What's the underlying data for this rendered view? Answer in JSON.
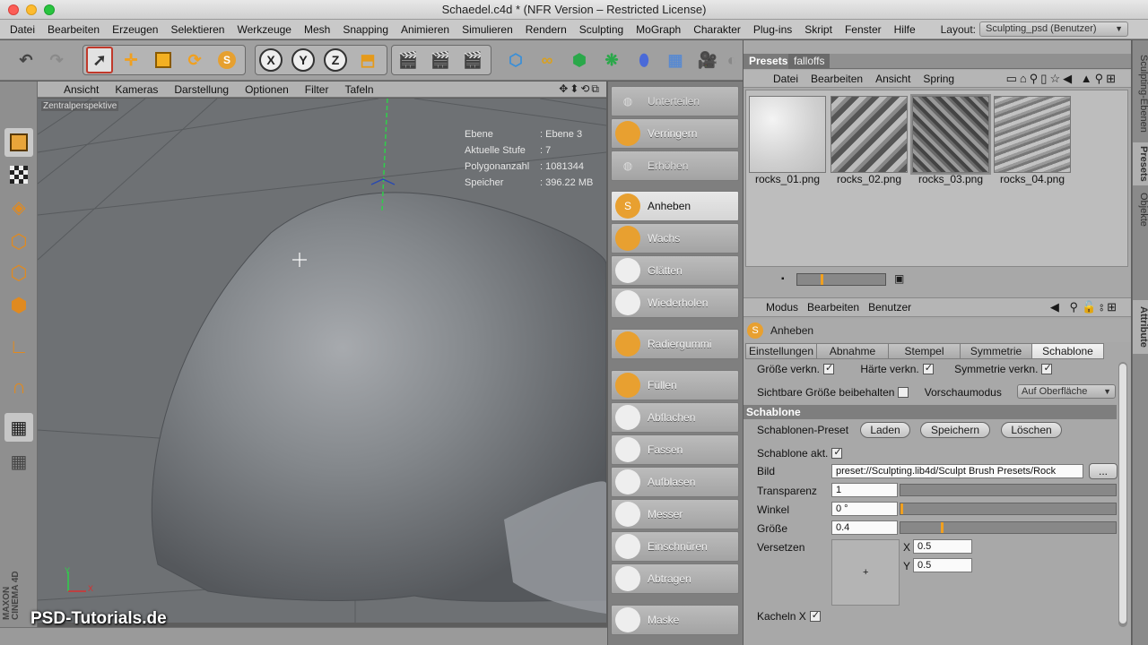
{
  "window": {
    "title": "Schaedel.c4d * (NFR Version – Restricted License)"
  },
  "menubar": {
    "items": [
      "Datei",
      "Bearbeiten",
      "Erzeugen",
      "Selektieren",
      "Werkzeuge",
      "Mesh",
      "Snapping",
      "Animieren",
      "Simulieren",
      "Rendern",
      "Sculpting",
      "MoGraph",
      "Charakter",
      "Plug-ins",
      "Skript",
      "Fenster",
      "Hilfe"
    ],
    "layout_label": "Layout:",
    "layout_value": "Sculpting_psd (Benutzer)"
  },
  "toolbar": {
    "axes": [
      "X",
      "Y",
      "Z"
    ]
  },
  "viewport": {
    "menu": [
      "Ansicht",
      "Kameras",
      "Darstellung",
      "Optionen",
      "Filter",
      "Tafeln"
    ],
    "camera_label": "Zentralperspektive",
    "hud": [
      {
        "key": "Ebene",
        "value": ": Ebene 3"
      },
      {
        "key": "Aktuelle Stufe",
        "value": ": 7"
      },
      {
        "key": "Polygonanzahl",
        "value": ": 1081344"
      },
      {
        "key": "Speicher",
        "value": ": 396.22 MB"
      }
    ],
    "watermark": "PSD-Tutorials.de",
    "brand": "MAXON CINEMA 4D",
    "axis_y": "Y",
    "axis_x": "X"
  },
  "brushes": [
    {
      "label": "Unterteilen",
      "state": "dim"
    },
    {
      "label": "Verringern",
      "state": "normal"
    },
    {
      "label": "Erhöhen",
      "state": "dim"
    },
    {
      "label": "Anheben",
      "state": "active"
    },
    {
      "label": "Wachs",
      "state": "normal"
    },
    {
      "label": "Glätten",
      "state": "normal"
    },
    {
      "label": "Wiederholen",
      "state": "normal"
    },
    {
      "label": "Radiergummi",
      "state": "normal"
    },
    {
      "label": "Füllen",
      "state": "normal"
    },
    {
      "label": "Abflachen",
      "state": "normal"
    },
    {
      "label": "Fassen",
      "state": "normal"
    },
    {
      "label": "Aufblasen",
      "state": "normal"
    },
    {
      "label": "Messer",
      "state": "normal"
    },
    {
      "label": "Einschnüren",
      "state": "normal"
    },
    {
      "label": "Abtragen",
      "state": "normal"
    },
    {
      "label": "Maske",
      "state": "normal"
    }
  ],
  "presets": {
    "tabs": [
      "Presets",
      "falloffs"
    ],
    "menu": [
      "Datei",
      "Bearbeiten",
      "Ansicht",
      "Spring"
    ],
    "items": [
      {
        "label": "rocks_01.png",
        "selected": false
      },
      {
        "label": "rocks_02.png",
        "selected": false
      },
      {
        "label": "rocks_03.png",
        "selected": true
      },
      {
        "label": "rocks_04.png",
        "selected": false
      }
    ]
  },
  "sidetabs": [
    "Sculpting-Ebenen",
    "Presets",
    "Objekte",
    "Attribute"
  ],
  "attributes": {
    "menu": [
      "Modus",
      "Bearbeiten",
      "Benutzer"
    ],
    "tool_name": "Anheben",
    "tabs": [
      "Einstellungen",
      "Abnahme",
      "Stempel",
      "Symmetrie",
      "Schablone"
    ],
    "selected_tab": "Schablone",
    "row1": {
      "size_link": "Größe verkn.",
      "hardness_link": "Härte verkn.",
      "sym_link": "Symmetrie verkn."
    },
    "row2": {
      "keep_size": "Sichtbare Größe beibehalten",
      "preview_label": "Vorschaumodus",
      "preview_value": "Auf Oberfläche"
    },
    "section": "Schablone",
    "preset_label": "Schablonen-Preset",
    "buttons": {
      "load": "Laden",
      "save": "Speichern",
      "delete": "Löschen"
    },
    "active_label": "Schablone akt.",
    "image_label": "Bild",
    "image_value": "preset://Sculpting.lib4d/Sculpt Brush Presets/Rock",
    "browse": "...",
    "transparency_label": "Transparenz",
    "transparency_value": "1",
    "angle_label": "Winkel",
    "angle_value": "0 °",
    "size_label": "Größe",
    "size_value": "0.4",
    "offset_label": "Versetzen",
    "offset_x_label": "X",
    "offset_x": "0.5",
    "offset_y_label": "Y",
    "offset_y": "0.5",
    "tile_x_label": "Kacheln X"
  }
}
